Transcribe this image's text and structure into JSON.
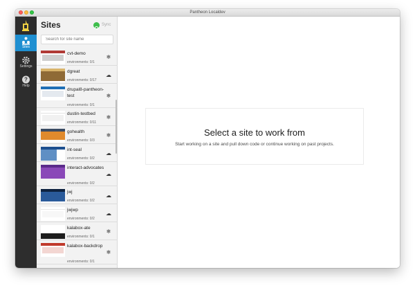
{
  "window": {
    "title": "Pantheon Localdev"
  },
  "nav": {
    "items": [
      {
        "label": "Sites",
        "icon": "sites-icon",
        "active": true
      },
      {
        "label": "Settings",
        "icon": "gear-icon",
        "active": false
      },
      {
        "label": "Help",
        "icon": "help-icon",
        "active": false
      }
    ]
  },
  "sites_panel": {
    "title": "Sites",
    "sync_label": "Sync",
    "search_placeholder": "Search for site name",
    "sites": [
      {
        "name": "cvt-demo",
        "environments": "environments: 0/1",
        "env_icon": "snowflake-icon"
      },
      {
        "name": "dgreat",
        "environments": "environments: 0/17",
        "env_icon": "cloud-icon"
      },
      {
        "name": "drupal8-pantheon-test",
        "environments": "environments: 0/1",
        "env_icon": "snowflake-icon"
      },
      {
        "name": "dustin-testbed",
        "environments": "environments: 0/11",
        "env_icon": "snowflake-icon"
      },
      {
        "name": "gohealth",
        "environments": "environments: 0/3",
        "env_icon": "snowflake-icon"
      },
      {
        "name": "int-seal",
        "environments": "environments: 0/2",
        "env_icon": "cloud-icon"
      },
      {
        "name": "interact-advocates",
        "environments": "environments: 0/2",
        "env_icon": "cloud-icon"
      },
      {
        "name": "jwj",
        "environments": "environments: 0/2",
        "env_icon": "cloud-icon"
      },
      {
        "name": "jwjwp",
        "environments": "environments: 0/2",
        "env_icon": "cloud-icon"
      },
      {
        "name": "kalabox-ate",
        "environments": "environments: 0/1",
        "env_icon": "snowflake-icon"
      },
      {
        "name": "kalabox-backdrop",
        "environments": "environments: 0/1",
        "env_icon": "snowflake-icon"
      }
    ]
  },
  "main": {
    "heading": "Select a site to work from",
    "subtext": "Start working on a site and pull down code or continue working on past projects."
  },
  "colors": {
    "accent": "#1f8fd1",
    "sync_green": "#3fbe4c",
    "rail_bg": "#2d2d2d"
  }
}
